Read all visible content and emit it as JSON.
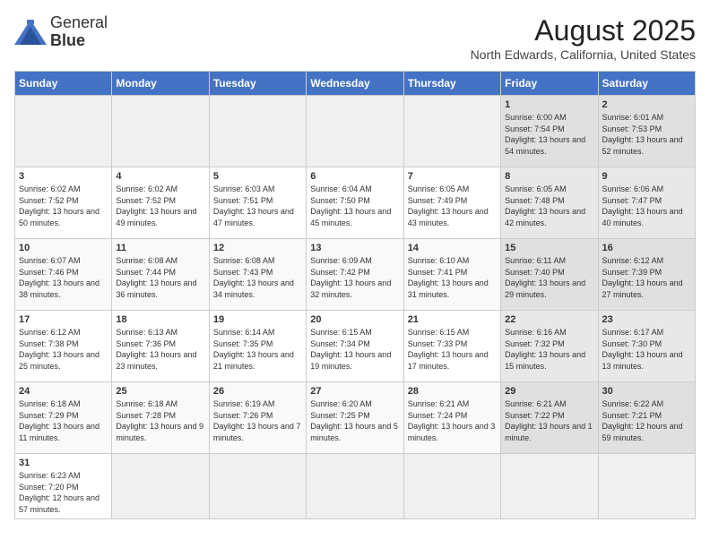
{
  "logo": {
    "text_normal": "General",
    "text_bold": "Blue"
  },
  "title": "August 2025",
  "subtitle": "North Edwards, California, United States",
  "days_of_week": [
    "Sunday",
    "Monday",
    "Tuesday",
    "Wednesday",
    "Thursday",
    "Friday",
    "Saturday"
  ],
  "weeks": [
    [
      {
        "day": "",
        "info": ""
      },
      {
        "day": "",
        "info": ""
      },
      {
        "day": "",
        "info": ""
      },
      {
        "day": "",
        "info": ""
      },
      {
        "day": "",
        "info": ""
      },
      {
        "day": "1",
        "info": "Sunrise: 6:00 AM\nSunset: 7:54 PM\nDaylight: 13 hours and 54 minutes."
      },
      {
        "day": "2",
        "info": "Sunrise: 6:01 AM\nSunset: 7:53 PM\nDaylight: 13 hours and 52 minutes."
      }
    ],
    [
      {
        "day": "3",
        "info": "Sunrise: 6:02 AM\nSunset: 7:52 PM\nDaylight: 13 hours and 50 minutes."
      },
      {
        "day": "4",
        "info": "Sunrise: 6:02 AM\nSunset: 7:52 PM\nDaylight: 13 hours and 49 minutes."
      },
      {
        "day": "5",
        "info": "Sunrise: 6:03 AM\nSunset: 7:51 PM\nDaylight: 13 hours and 47 minutes."
      },
      {
        "day": "6",
        "info": "Sunrise: 6:04 AM\nSunset: 7:50 PM\nDaylight: 13 hours and 45 minutes."
      },
      {
        "day": "7",
        "info": "Sunrise: 6:05 AM\nSunset: 7:49 PM\nDaylight: 13 hours and 43 minutes."
      },
      {
        "day": "8",
        "info": "Sunrise: 6:05 AM\nSunset: 7:48 PM\nDaylight: 13 hours and 42 minutes."
      },
      {
        "day": "9",
        "info": "Sunrise: 6:06 AM\nSunset: 7:47 PM\nDaylight: 13 hours and 40 minutes."
      }
    ],
    [
      {
        "day": "10",
        "info": "Sunrise: 6:07 AM\nSunset: 7:46 PM\nDaylight: 13 hours and 38 minutes."
      },
      {
        "day": "11",
        "info": "Sunrise: 6:08 AM\nSunset: 7:44 PM\nDaylight: 13 hours and 36 minutes."
      },
      {
        "day": "12",
        "info": "Sunrise: 6:08 AM\nSunset: 7:43 PM\nDaylight: 13 hours and 34 minutes."
      },
      {
        "day": "13",
        "info": "Sunrise: 6:09 AM\nSunset: 7:42 PM\nDaylight: 13 hours and 32 minutes."
      },
      {
        "day": "14",
        "info": "Sunrise: 6:10 AM\nSunset: 7:41 PM\nDaylight: 13 hours and 31 minutes."
      },
      {
        "day": "15",
        "info": "Sunrise: 6:11 AM\nSunset: 7:40 PM\nDaylight: 13 hours and 29 minutes."
      },
      {
        "day": "16",
        "info": "Sunrise: 6:12 AM\nSunset: 7:39 PM\nDaylight: 13 hours and 27 minutes."
      }
    ],
    [
      {
        "day": "17",
        "info": "Sunrise: 6:12 AM\nSunset: 7:38 PM\nDaylight: 13 hours and 25 minutes."
      },
      {
        "day": "18",
        "info": "Sunrise: 6:13 AM\nSunset: 7:36 PM\nDaylight: 13 hours and 23 minutes."
      },
      {
        "day": "19",
        "info": "Sunrise: 6:14 AM\nSunset: 7:35 PM\nDaylight: 13 hours and 21 minutes."
      },
      {
        "day": "20",
        "info": "Sunrise: 6:15 AM\nSunset: 7:34 PM\nDaylight: 13 hours and 19 minutes."
      },
      {
        "day": "21",
        "info": "Sunrise: 6:15 AM\nSunset: 7:33 PM\nDaylight: 13 hours and 17 minutes."
      },
      {
        "day": "22",
        "info": "Sunrise: 6:16 AM\nSunset: 7:32 PM\nDaylight: 13 hours and 15 minutes."
      },
      {
        "day": "23",
        "info": "Sunrise: 6:17 AM\nSunset: 7:30 PM\nDaylight: 13 hours and 13 minutes."
      }
    ],
    [
      {
        "day": "24",
        "info": "Sunrise: 6:18 AM\nSunset: 7:29 PM\nDaylight: 13 hours and 11 minutes."
      },
      {
        "day": "25",
        "info": "Sunrise: 6:18 AM\nSunset: 7:28 PM\nDaylight: 13 hours and 9 minutes."
      },
      {
        "day": "26",
        "info": "Sunrise: 6:19 AM\nSunset: 7:26 PM\nDaylight: 13 hours and 7 minutes."
      },
      {
        "day": "27",
        "info": "Sunrise: 6:20 AM\nSunset: 7:25 PM\nDaylight: 13 hours and 5 minutes."
      },
      {
        "day": "28",
        "info": "Sunrise: 6:21 AM\nSunset: 7:24 PM\nDaylight: 13 hours and 3 minutes."
      },
      {
        "day": "29",
        "info": "Sunrise: 6:21 AM\nSunset: 7:22 PM\nDaylight: 13 hours and 1 minute."
      },
      {
        "day": "30",
        "info": "Sunrise: 6:22 AM\nSunset: 7:21 PM\nDaylight: 12 hours and 59 minutes."
      }
    ],
    [
      {
        "day": "31",
        "info": "Sunrise: 6:23 AM\nSunset: 7:20 PM\nDaylight: 12 hours and 57 minutes."
      },
      {
        "day": "",
        "info": ""
      },
      {
        "day": "",
        "info": ""
      },
      {
        "day": "",
        "info": ""
      },
      {
        "day": "",
        "info": ""
      },
      {
        "day": "",
        "info": ""
      },
      {
        "day": "",
        "info": ""
      }
    ]
  ]
}
